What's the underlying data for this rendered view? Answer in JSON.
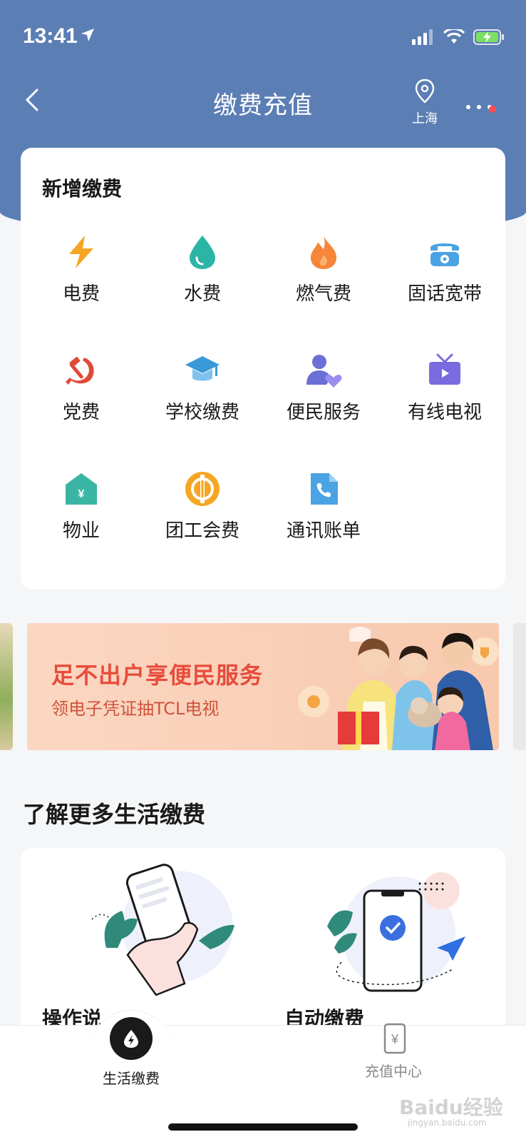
{
  "status_bar": {
    "time": "13:41"
  },
  "nav": {
    "title": "缴费充值",
    "location": "上海"
  },
  "new_payment": {
    "title": "新增缴费",
    "items": [
      {
        "label": "电费",
        "icon": "lightning-icon",
        "color": "#f5a623"
      },
      {
        "label": "水费",
        "icon": "water-drop-icon",
        "color": "#2bb5a7"
      },
      {
        "label": "燃气费",
        "icon": "flame-icon",
        "color": "#f5863a"
      },
      {
        "label": "固话宽带",
        "icon": "telephone-icon",
        "color": "#4aa3e3"
      },
      {
        "label": "党费",
        "icon": "hammer-sickle-icon",
        "color": "#e04a3a"
      },
      {
        "label": "学校缴费",
        "icon": "graduation-cap-icon",
        "color": "#3a9ad9"
      },
      {
        "label": "便民服务",
        "icon": "person-heart-icon",
        "color": "#6b6fd6"
      },
      {
        "label": "有线电视",
        "icon": "tv-icon",
        "color": "#7a6be0"
      },
      {
        "label": "物业",
        "icon": "property-house-icon",
        "color": "#3bb5a3"
      },
      {
        "label": "团工会费",
        "icon": "union-badge-icon",
        "color": "#f5a623"
      },
      {
        "label": "通讯账单",
        "icon": "phone-bill-icon",
        "color": "#4aa3e3"
      }
    ]
  },
  "banner": {
    "title": "足不出户享便民服务",
    "subtitle": "领电子凭证抽TCL电视"
  },
  "more_section": {
    "title": "了解更多生活缴费",
    "items": [
      {
        "label": "操作说"
      },
      {
        "label": "自动缴费"
      }
    ]
  },
  "tabs": [
    {
      "label": "生活缴费",
      "icon": "life-payment-icon",
      "active": true
    },
    {
      "label": "充值中心",
      "icon": "recharge-icon",
      "active": false
    }
  ],
  "watermark": {
    "text": "Baidu经验",
    "sub": "jingyan.baidu.com"
  }
}
